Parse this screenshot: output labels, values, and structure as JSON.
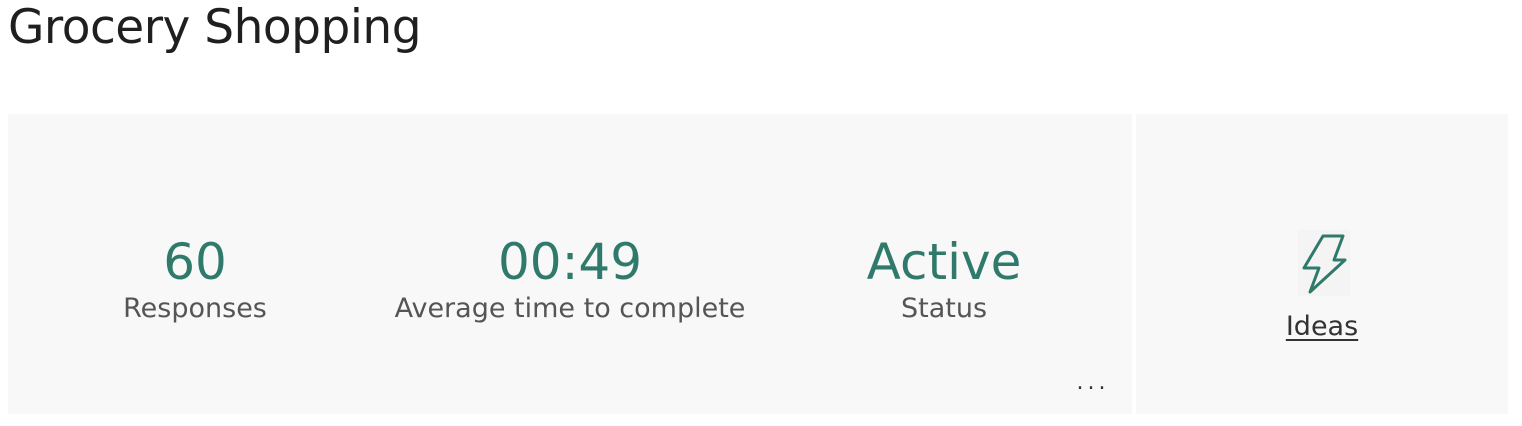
{
  "page": {
    "title": "Grocery Shopping"
  },
  "summary": {
    "responses": {
      "value": "60",
      "label": "Responses"
    },
    "average_time": {
      "value": "00:49",
      "label": "Average time to complete"
    },
    "status": {
      "value": "Active",
      "label": "Status"
    },
    "more_label": "..."
  },
  "ideas": {
    "label": "Ideas",
    "icon": "lightning-bolt-icon"
  },
  "colors": {
    "accent": "#2f7a6b",
    "panel_background": "#f8f8f8",
    "label_text": "#555555"
  }
}
